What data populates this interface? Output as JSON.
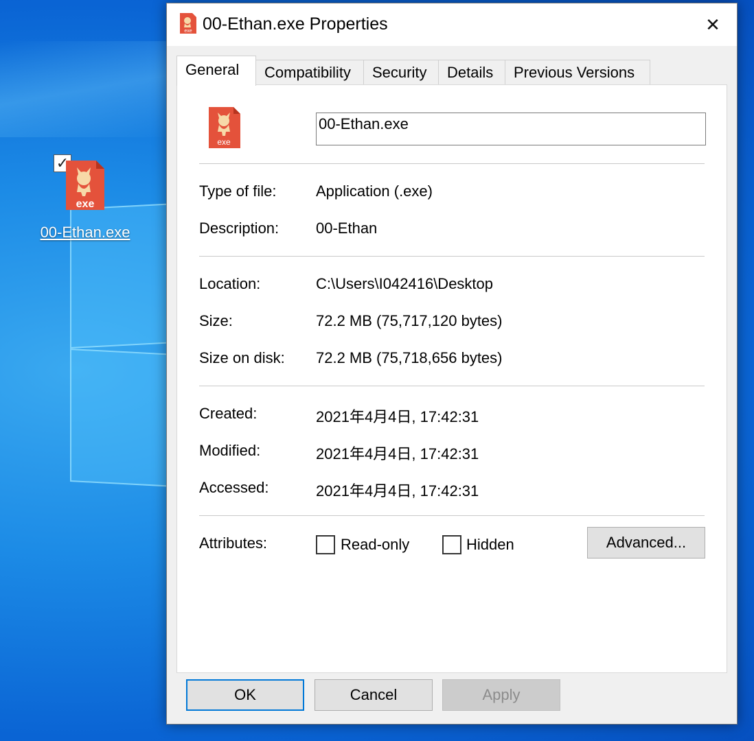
{
  "desktop": {
    "icon_label": "00-Ethan.exe",
    "icon_checked": true
  },
  "dialog": {
    "title": "00-Ethan.exe Properties",
    "close_glyph": "✕",
    "tabs": [
      {
        "label": "General",
        "active": true
      },
      {
        "label": "Compatibility",
        "active": false
      },
      {
        "label": "Security",
        "active": false
      },
      {
        "label": "Details",
        "active": false
      },
      {
        "label": "Previous Versions",
        "active": false
      }
    ],
    "file_name_value": "00-Ethan.exe",
    "icon_badge_text": "exe",
    "fields": {
      "type_label": "Type of file:",
      "type_value": "Application (.exe)",
      "description_label": "Description:",
      "description_value": "00-Ethan",
      "location_label": "Location:",
      "location_value": "C:\\Users\\I042416\\Desktop",
      "size_label": "Size:",
      "size_value": "72.2 MB (75,717,120 bytes)",
      "size_on_disk_label": "Size on disk:",
      "size_on_disk_value": "72.2 MB (75,718,656 bytes)",
      "created_label": "Created:",
      "created_value": "2021年4月4日, 17:42:31",
      "modified_label": "Modified:",
      "modified_value": "2021年4月4日, 17:42:31",
      "accessed_label": "Accessed:",
      "accessed_value": "2021年4月4日, 17:42:31",
      "attributes_label": "Attributes:"
    },
    "attributes": {
      "readonly_label": "Read-only",
      "readonly_checked": false,
      "hidden_label": "Hidden",
      "hidden_checked": false,
      "advanced_label": "Advanced..."
    },
    "buttons": {
      "ok": "OK",
      "cancel": "Cancel",
      "apply": "Apply",
      "apply_enabled": false
    }
  },
  "colors": {
    "exe_icon": "#e4523b",
    "exe_icon_figure": "#f7d9a8",
    "focus_border": "#0078d7"
  }
}
